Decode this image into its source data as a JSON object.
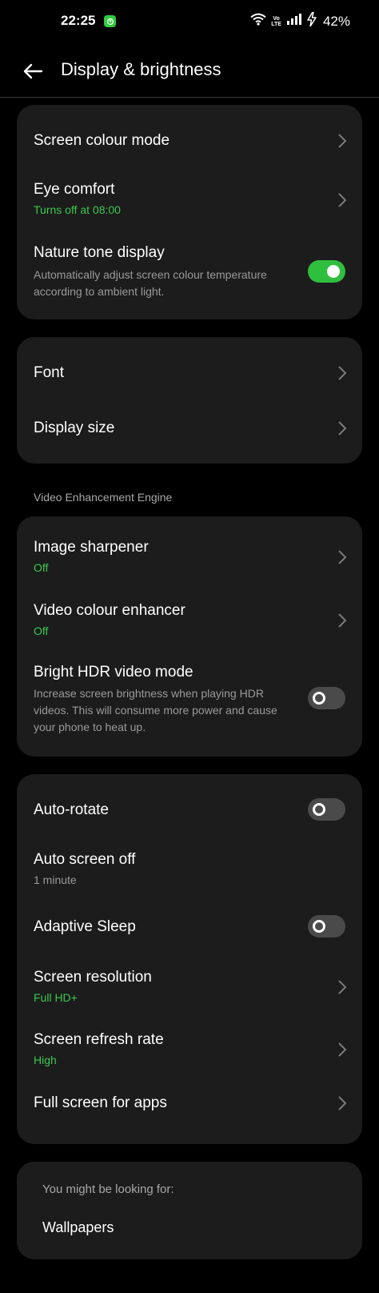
{
  "status_bar": {
    "time": "22:25",
    "volte_top": "Vo",
    "volte_bottom": "LTE",
    "battery": "42%",
    "icons": [
      "app-notification-icon",
      "wifi-icon",
      "volte-icon",
      "signal-icon",
      "charging-icon"
    ]
  },
  "header": {
    "title": "Display & brightness",
    "back_icon": "arrow-left-icon"
  },
  "card1": {
    "screen_colour_mode": "Screen colour mode",
    "eye_comfort": "Eye comfort",
    "eye_comfort_sub": "Turns off at 08:00",
    "nature_tone": "Nature tone display",
    "nature_tone_desc": "Automatically adjust screen colour temperature according to ambient light.",
    "nature_tone_on": true
  },
  "card2": {
    "font": "Font",
    "display_size": "Display size"
  },
  "section_video": "Video Enhancement Engine",
  "card3": {
    "image_sharpener": "Image sharpener",
    "image_sharpener_sub": "Off",
    "video_colour": "Video colour enhancer",
    "video_colour_sub": "Off",
    "bright_hdr": "Bright HDR video mode",
    "bright_hdr_desc": "Increase screen brightness when playing HDR videos. This will consume more power and cause your phone to heat up.",
    "bright_hdr_on": false
  },
  "card4": {
    "auto_rotate": "Auto-rotate",
    "auto_rotate_on": false,
    "auto_screen_off": "Auto screen off",
    "auto_screen_off_sub": "1 minute",
    "adaptive_sleep": "Adaptive Sleep",
    "adaptive_sleep_on": false,
    "screen_resolution": "Screen resolution",
    "screen_resolution_sub": "Full HD+",
    "refresh_rate": "Screen refresh rate",
    "refresh_rate_sub": "High",
    "full_screen_apps": "Full screen for apps"
  },
  "suggestions": {
    "label": "You might be looking for:",
    "item": "Wallpapers"
  },
  "colors": {
    "background": "#000000",
    "card": "#1c1c1c",
    "accent_green": "#3ac84e",
    "toggle_on": "#2fbf3f",
    "toggle_off": "#4a4a4a"
  }
}
